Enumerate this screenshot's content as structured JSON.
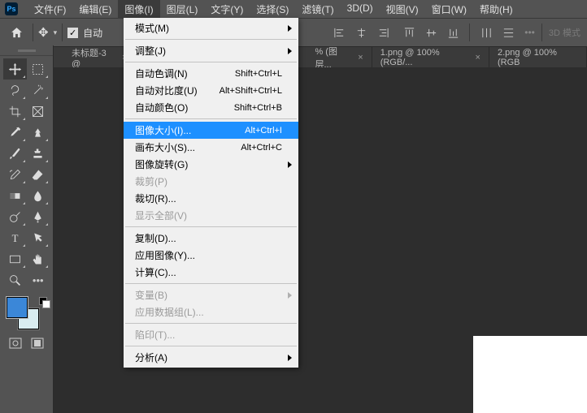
{
  "app": {
    "logo": "Ps"
  },
  "menu": {
    "items": [
      "文件(F)",
      "编辑(E)",
      "图像(I)",
      "图层(L)",
      "文字(Y)",
      "选择(S)",
      "滤镜(T)",
      "3D(D)",
      "视图(V)",
      "窗口(W)",
      "帮助(H)"
    ],
    "active_index": 2
  },
  "options": {
    "auto_label": "自动",
    "mode3d": "3D 模式"
  },
  "tabs": [
    {
      "label": "未标题-3 @",
      "close": "×"
    },
    {
      "label": "% (图层...",
      "close": "×"
    },
    {
      "label": "1.png @ 100%(RGB/...",
      "close": "×"
    },
    {
      "label": "2.png @ 100%(RGB"
    }
  ],
  "dropdown": [
    {
      "label": "模式(M)",
      "submenu": true
    },
    {
      "sep": true
    },
    {
      "label": "调整(J)",
      "submenu": true
    },
    {
      "sep": true
    },
    {
      "label": "自动色调(N)",
      "shortcut": "Shift+Ctrl+L"
    },
    {
      "label": "自动对比度(U)",
      "shortcut": "Alt+Shift+Ctrl+L"
    },
    {
      "label": "自动颜色(O)",
      "shortcut": "Shift+Ctrl+B"
    },
    {
      "sep": true
    },
    {
      "label": "图像大小(I)...",
      "shortcut": "Alt+Ctrl+I",
      "hl": true
    },
    {
      "label": "画布大小(S)...",
      "shortcut": "Alt+Ctrl+C"
    },
    {
      "label": "图像旋转(G)",
      "submenu": true
    },
    {
      "label": "裁剪(P)",
      "disabled": true
    },
    {
      "label": "裁切(R)..."
    },
    {
      "label": "显示全部(V)",
      "disabled": true
    },
    {
      "sep": true
    },
    {
      "label": "复制(D)..."
    },
    {
      "label": "应用图像(Y)..."
    },
    {
      "label": "计算(C)..."
    },
    {
      "sep": true
    },
    {
      "label": "变量(B)",
      "submenu": true,
      "disabled": true
    },
    {
      "label": "应用数据组(L)...",
      "disabled": true
    },
    {
      "sep": true
    },
    {
      "label": "陷印(T)...",
      "disabled": true
    },
    {
      "sep": true
    },
    {
      "label": "分析(A)",
      "submenu": true
    }
  ]
}
